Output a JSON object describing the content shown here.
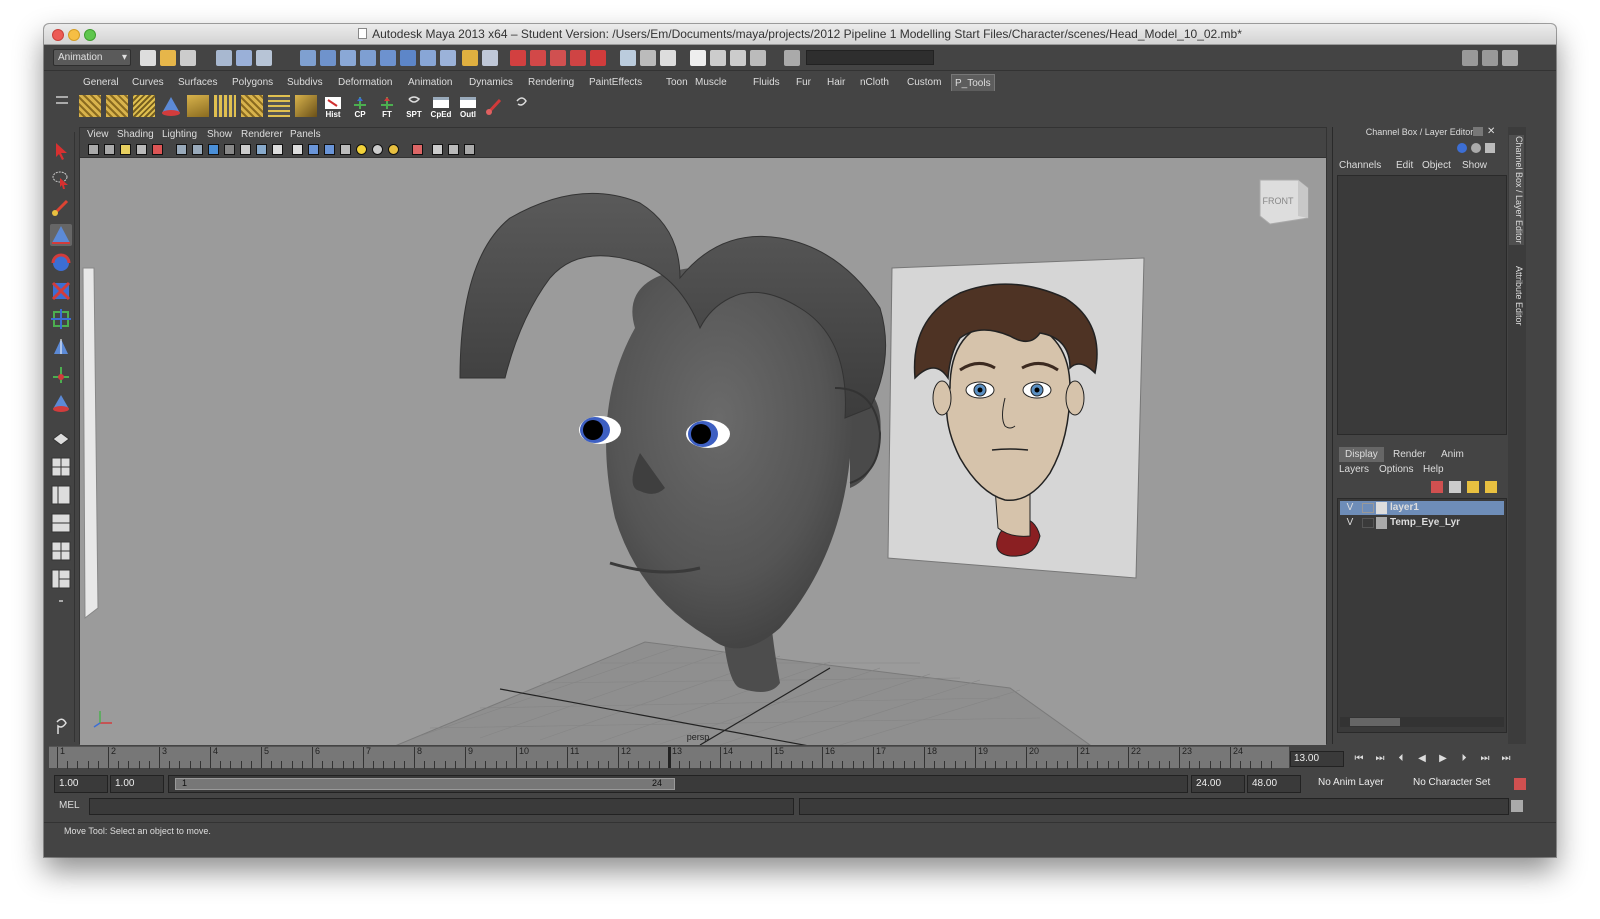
{
  "window": {
    "title": "Autodesk Maya 2013 x64 – Student Version: /Users/Em/Documents/maya/projects/2012 Pipeline 1 Modelling Start Files/Character/scenes/Head_Model_10_02.mb*"
  },
  "status_line": {
    "mode": "Animation"
  },
  "shelf_tabs": [
    "General",
    "Curves",
    "Surfaces",
    "Polygons",
    "Subdivs",
    "Deformation",
    "Animation",
    "Dynamics",
    "Rendering",
    "PaintEffects",
    "Toon",
    "Muscle",
    "Fluids",
    "Fur",
    "Hair",
    "nCloth",
    "Custom",
    "P_Tools"
  ],
  "active_shelf_tab": "P_Tools",
  "shelf_labels": [
    "Hist",
    "CP",
    "FT",
    "SPT",
    "CpEd",
    "Outl"
  ],
  "viewport": {
    "menu": [
      "View",
      "Shading",
      "Lighting",
      "Show",
      "Renderer",
      "Panels"
    ],
    "camera_label": "persp",
    "view_cube_label": "FRONT"
  },
  "right_panel": {
    "title": "Channel Box / Layer Editor",
    "channel_menu": [
      "Channels",
      "Edit",
      "Object",
      "Show"
    ],
    "layer_tabs": [
      "Display",
      "Render",
      "Anim"
    ],
    "active_layer_tab": "Display",
    "layer_menu": [
      "Layers",
      "Options",
      "Help"
    ],
    "layers": [
      {
        "visible": "V",
        "name": "layer1"
      },
      {
        "visible": "V",
        "name": "Temp_Eye_Lyr"
      }
    ],
    "side_tabs": [
      "Channel Box / Layer Editor",
      "Attribute Editor"
    ]
  },
  "timeline": {
    "ticks": [
      "1",
      "2",
      "3",
      "4",
      "5",
      "6",
      "7",
      "8",
      "9",
      "10",
      "11",
      "12",
      "13",
      "14",
      "15",
      "16",
      "17",
      "18",
      "19",
      "20",
      "21",
      "22",
      "23",
      "24"
    ],
    "current_frame": "13.00"
  },
  "range": {
    "start": "1.00",
    "anim_start": "1.00",
    "slider_start": "1",
    "slider_end": "24",
    "end": "24.00",
    "anim_end": "48.00",
    "anim_layer": "No Anim Layer",
    "character_set": "No Character Set"
  },
  "command_line": {
    "label": "MEL"
  },
  "help_line": {
    "text": "Move Tool: Select an object to move."
  },
  "colors": {
    "bg": "#444444",
    "viewport": "#9b9b9b",
    "selected_layer": "#6e8db8",
    "skin_model": "#555555",
    "eyes": "#3d5fc2"
  }
}
